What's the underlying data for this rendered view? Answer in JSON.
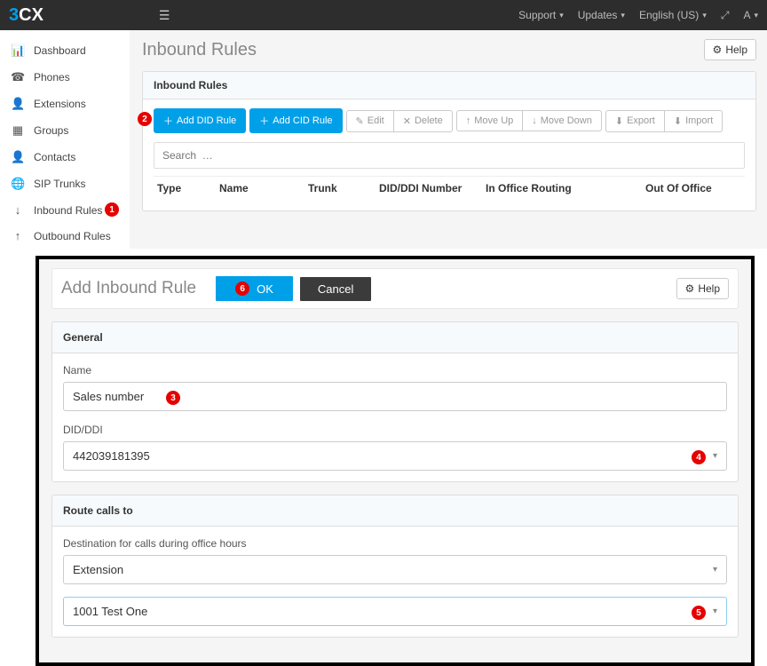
{
  "navbar": {
    "support": "Support",
    "updates": "Updates",
    "language": "English (US)",
    "user": "A"
  },
  "sidebar": {
    "items": [
      {
        "label": "Dashboard"
      },
      {
        "label": "Phones"
      },
      {
        "label": "Extensions"
      },
      {
        "label": "Groups"
      },
      {
        "label": "Contacts"
      },
      {
        "label": "SIP Trunks"
      },
      {
        "label": "Inbound Rules"
      },
      {
        "label": "Outbound Rules"
      }
    ]
  },
  "page": {
    "title": "Inbound Rules",
    "help": "Help"
  },
  "rules_panel": {
    "heading": "Inbound Rules",
    "toolbar": {
      "add_did": "Add DID Rule",
      "add_cid": "Add CID Rule",
      "edit": "Edit",
      "delete": "Delete",
      "move_up": "Move Up",
      "move_down": "Move Down",
      "export": "Export",
      "import": "Import"
    },
    "search_placeholder": "Search  …",
    "columns": {
      "type": "Type",
      "name": "Name",
      "trunk": "Trunk",
      "did": "DID/DDI Number",
      "in_office": "In Office Routing",
      "out_office": "Out Of Office"
    }
  },
  "add_rule": {
    "title": "Add Inbound Rule",
    "ok": "OK",
    "cancel": "Cancel",
    "help": "Help",
    "general": {
      "heading": "General",
      "name_label": "Name",
      "name_value": "Sales number",
      "did_label": "DID/DDI",
      "did_value": "442039181395"
    },
    "route": {
      "heading": "Route calls to",
      "dest_label": "Destination for calls during office hours",
      "dest_value": "Extension",
      "ext_value": "1001 Test One"
    }
  },
  "markers": {
    "m1": "1",
    "m2": "2",
    "m3": "3",
    "m4": "4",
    "m5": "5",
    "m6": "6"
  }
}
